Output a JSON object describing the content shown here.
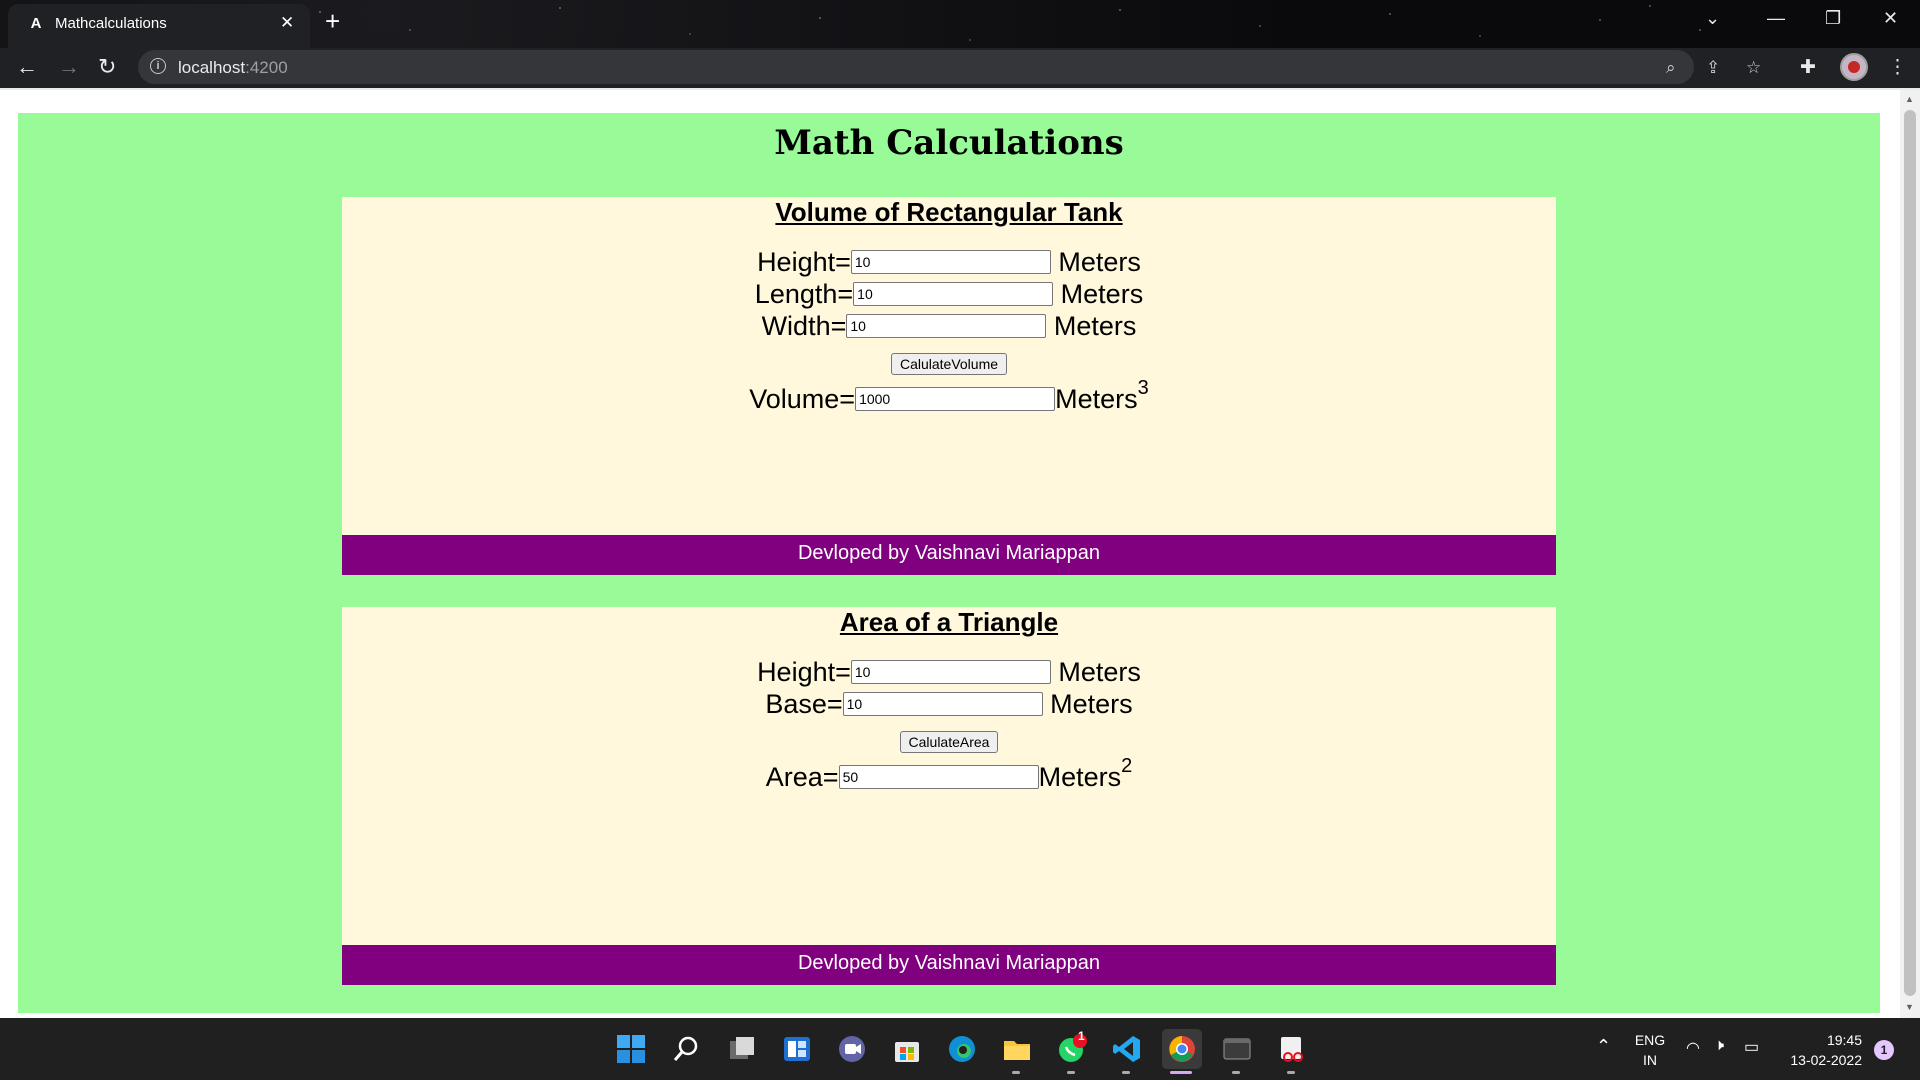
{
  "browser": {
    "tab_title": "Mathcalculations",
    "favicon_letter": "A",
    "url_host": "localhost",
    "url_port": ":4200"
  },
  "page": {
    "title": "Math Calculations",
    "volume_card": {
      "heading": "Volume of Rectangular Tank",
      "height_label": "Height=",
      "height_value": "10",
      "length_label": "Length=",
      "length_value": "10",
      "width_label": "Width=",
      "width_value": "10",
      "unit": "Meters",
      "button_label": "CalulateVolume",
      "result_label": "Volume=",
      "result_value": "1000",
      "result_unit": "Meters",
      "result_exponent": "3",
      "footer": "Devloped by Vaishnavi Mariappan"
    },
    "area_card": {
      "heading": "Area of a Triangle",
      "height_label": "Height=",
      "height_value": "10",
      "base_label": "Base=",
      "base_value": "10",
      "unit": "Meters",
      "button_label": "CalulateArea",
      "result_label": "Area=",
      "result_value": "50",
      "result_unit": "Meters",
      "result_exponent": "2",
      "footer": "Devloped by Vaishnavi Mariappan"
    }
  },
  "taskbar": {
    "language": "ENG",
    "region": "IN",
    "time": "19:45",
    "date": "13-02-2022",
    "notification_count": "1",
    "whatsapp_badge": "1"
  },
  "colors": {
    "app_background": "#98fb98",
    "card_background": "#fff8dc",
    "footer_background": "#800080"
  }
}
